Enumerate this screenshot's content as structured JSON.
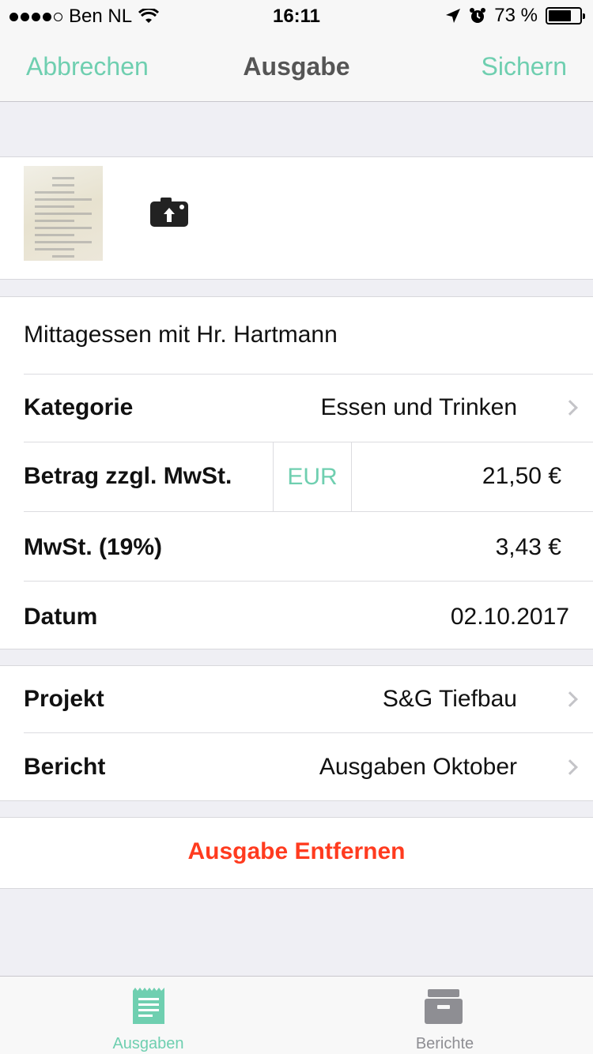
{
  "status_bar": {
    "carrier": "Ben NL",
    "time": "16:11",
    "battery_percent": "73 %",
    "battery_level": 0.73
  },
  "nav": {
    "cancel_label": "Abbrechen",
    "title": "Ausgabe",
    "save_label": "Sichern"
  },
  "expense": {
    "description": "Mittagessen mit Hr. Hartmann",
    "category_label": "Kategorie",
    "category_value": "Essen und Trinken",
    "amount_label": "Betrag zzgl. MwSt.",
    "currency": "EUR",
    "amount_value": "21,50 €",
    "vat_label": "MwSt. (19%)",
    "vat_value": "3,43 €",
    "date_label": "Datum",
    "date_value": "02.10.2017"
  },
  "assignment": {
    "project_label": "Projekt",
    "project_value": "S&G Tiefbau",
    "report_label": "Bericht",
    "report_value": "Ausgaben Oktober"
  },
  "delete_label": "Ausgabe Entfernen",
  "tabs": [
    {
      "label": "Ausgaben",
      "icon": "receipt-icon",
      "active": true
    },
    {
      "label": "Berichte",
      "icon": "archive-box-icon",
      "active": false
    }
  ],
  "colors": {
    "accent": "#6fcfb0",
    "destructive": "#ff3b1f",
    "background": "#efeff4"
  }
}
